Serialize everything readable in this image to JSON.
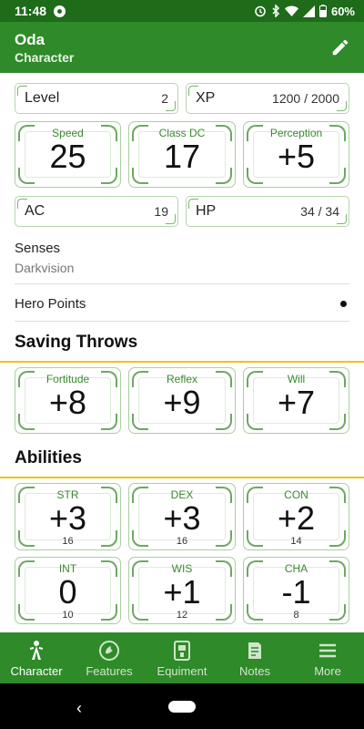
{
  "status": {
    "time": "11:48",
    "battery": "60%"
  },
  "appbar": {
    "title": "Oda",
    "subtitle": "Character"
  },
  "stats": {
    "level": {
      "label": "Level",
      "value": "2"
    },
    "xp": {
      "label": "XP",
      "value": "1200 / 2000"
    },
    "speed": {
      "label": "Speed",
      "value": "25"
    },
    "class_dc": {
      "label": "Class DC",
      "value": "17"
    },
    "perception": {
      "label": "Perception",
      "value": "+5"
    },
    "ac": {
      "label": "AC",
      "value": "19"
    },
    "hp": {
      "label": "HP",
      "value": "34 / 34"
    }
  },
  "senses": {
    "label": "Senses",
    "value": "Darkvision"
  },
  "hero_points": {
    "label": "Hero Points"
  },
  "saving_throws": {
    "title": "Saving Throws",
    "items": [
      {
        "label": "Fortitude",
        "value": "+8"
      },
      {
        "label": "Reflex",
        "value": "+9"
      },
      {
        "label": "Will",
        "value": "+7"
      }
    ]
  },
  "abilities": {
    "title": "Abilities",
    "items": [
      {
        "label": "STR",
        "mod": "+3",
        "score": "16"
      },
      {
        "label": "DEX",
        "mod": "+3",
        "score": "16"
      },
      {
        "label": "CON",
        "mod": "+2",
        "score": "14"
      },
      {
        "label": "INT",
        "mod": "0",
        "score": "10"
      },
      {
        "label": "WIS",
        "mod": "+1",
        "score": "12"
      },
      {
        "label": "CHA",
        "mod": "-1",
        "score": "8"
      }
    ]
  },
  "nav": {
    "items": [
      {
        "label": "Character",
        "icon": "character-icon",
        "active": true
      },
      {
        "label": "Features",
        "icon": "features-icon"
      },
      {
        "label": "Equiment",
        "icon": "equipment-icon"
      },
      {
        "label": "Notes",
        "icon": "notes-icon"
      },
      {
        "label": "More",
        "icon": "menu-icon"
      }
    ]
  },
  "colors": {
    "primary": "#2f8a2a",
    "status": "#1e6b1a",
    "accent": "#f1c40f",
    "ornament": "#6ea862"
  }
}
